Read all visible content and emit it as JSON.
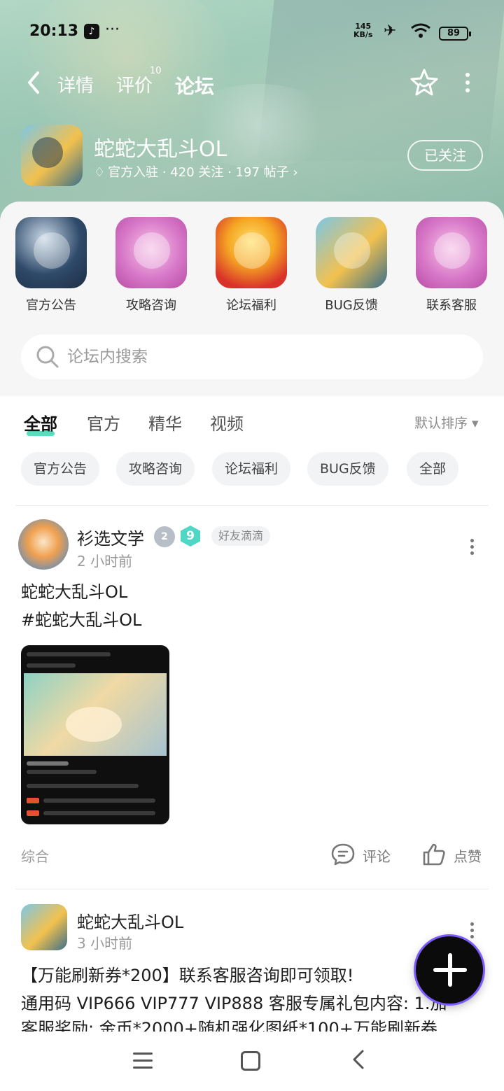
{
  "status_bar": {
    "time": "20:13",
    "more": "···",
    "speed_value": "145",
    "speed_unit": "KB/s",
    "battery": "89"
  },
  "nav": {
    "tabs": [
      {
        "label": "详情"
      },
      {
        "label": "评价",
        "badge": "10"
      },
      {
        "label": "论坛"
      }
    ],
    "active_tab": "论坛"
  },
  "game": {
    "name": "蛇蛇大乱斗OL",
    "meta": "官方入驻 · 420 关注 · 197 帖子 ›",
    "follow_label": "已关注"
  },
  "quick_links": [
    {
      "label": "官方公告"
    },
    {
      "label": "攻略咨询"
    },
    {
      "label": "论坛福利"
    },
    {
      "label": "BUG反馈"
    },
    {
      "label": "联系客服"
    }
  ],
  "search": {
    "placeholder": "论坛内搜索"
  },
  "content_tabs": [
    {
      "label": "全部"
    },
    {
      "label": "官方"
    },
    {
      "label": "精华"
    },
    {
      "label": "视频"
    }
  ],
  "sort_label": "默认排序 ▾",
  "chips": [
    {
      "label": "官方公告"
    },
    {
      "label": "攻略咨询"
    },
    {
      "label": "论坛福利"
    },
    {
      "label": "BUG反馈"
    },
    {
      "label": "全部"
    }
  ],
  "posts": [
    {
      "author": "衫选文学",
      "level_badge": "2",
      "vip_badge": "9",
      "tag": "好友滴滴",
      "time": "2 小时前",
      "line1": "蛇蛇大乱斗OL",
      "line2": "#蛇蛇大乱斗OL",
      "category": "综合",
      "comment_label": "评论",
      "like_label": "点赞"
    },
    {
      "author": "蛇蛇大乱斗OL",
      "time": "3 小时前",
      "line1": "【万能刷新券*200】联系客服咨询即可领取!",
      "line2": "通用码 VIP666 VIP777 VIP888 客服专属礼包内容: 1.加",
      "line3": "客服奖励: 金币*2000+随机强化图纸*100+万能刷新券"
    }
  ]
}
